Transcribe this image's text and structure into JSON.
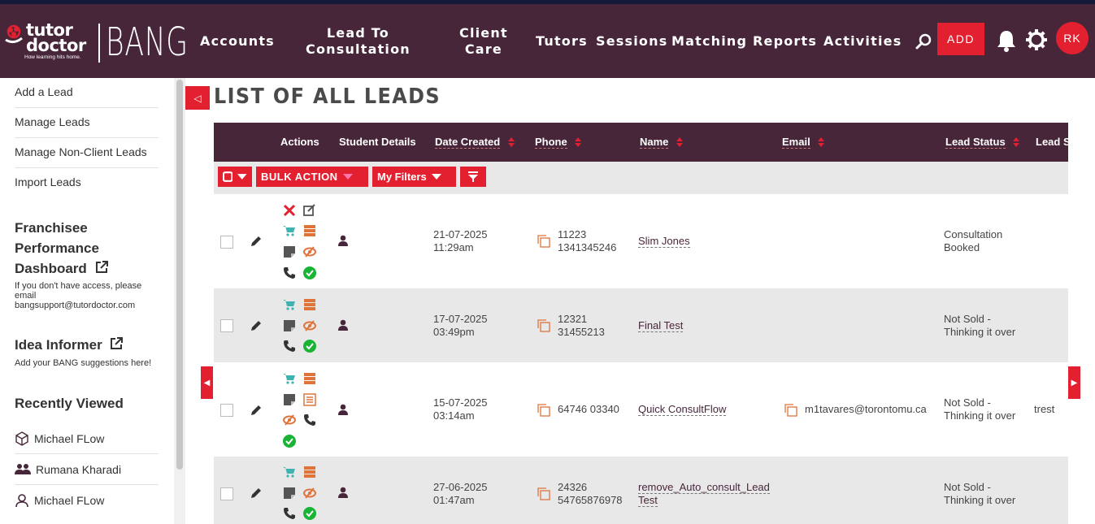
{
  "brand": {
    "logo_line1": "tutor",
    "logo_line2": "doctor",
    "logo_tagline": "How learning hits home.",
    "app_name": "BANG"
  },
  "nav": {
    "items": [
      {
        "label": "Accounts"
      },
      {
        "label": "Lead To\nConsultation"
      },
      {
        "label": "Client\nCare"
      },
      {
        "label": "Tutors"
      },
      {
        "label": "Sessions"
      },
      {
        "label": "Matching"
      },
      {
        "label": "Reports"
      },
      {
        "label": "Activities"
      }
    ],
    "add_label": "ADD",
    "avatar_initials": "RK",
    "icons": [
      "search-icon",
      "bell-icon",
      "gear-icon"
    ]
  },
  "sidebar": {
    "links": [
      "Add a Lead",
      "Manage Leads",
      "Manage Non-Client Leads",
      "Import Leads"
    ],
    "dashboard": {
      "line1": "Franchisee",
      "line2": "Performance",
      "line3": "Dashboard",
      "note": "If you don't have access, please email bangsupport@tutordoctor.com"
    },
    "idea": {
      "title": "Idea Informer",
      "note": "Add your BANG suggestions here!"
    },
    "recently_viewed": {
      "title": "Recently Viewed",
      "items": [
        {
          "label": "Michael FLow",
          "icon": "cube-icon"
        },
        {
          "label": "Rumana Kharadi",
          "icon": "users-icon"
        },
        {
          "label": "Michael FLow",
          "icon": "user-outline-icon"
        }
      ]
    }
  },
  "page": {
    "title": "LIST OF ALL LEADS"
  },
  "table": {
    "headers": [
      "Actions",
      "Student Details",
      "Date Created",
      "Phone",
      "Name",
      "Email",
      "Lead Status",
      "Lead St"
    ],
    "filters": {
      "bulk_action": "BULK ACTION",
      "my_filters": "My Filters"
    },
    "rows": [
      {
        "date": "21-07-2025",
        "time": "11:29am",
        "phone1": "11223",
        "phone2": "1341345246",
        "name1": "Slim Jones",
        "name2": "",
        "email": "",
        "status1": "Consultation",
        "status2": "Booked",
        "extra": ""
      },
      {
        "date": "17-07-2025",
        "time": "03:49pm",
        "phone1": "12321",
        "phone2": "31455213",
        "name1": "Final Test",
        "name2": "",
        "email": "",
        "status1": "Not Sold -",
        "status2": "Thinking it over",
        "extra": ""
      },
      {
        "date": "15-07-2025",
        "time": "03:14am",
        "phone1": "64746 03340",
        "phone2": "",
        "name1": "Quick ConsultFlow",
        "name2": "",
        "email": "m1tavares@torontomu.ca",
        "status1": "Not Sold -",
        "status2": "Thinking it over",
        "extra": "trest"
      },
      {
        "date": "27-06-2025",
        "time": "01:47am",
        "phone1": "24326",
        "phone2": "54765876978",
        "name1": "remove_Auto_consult_Lead",
        "name2": "Test",
        "email": "",
        "status1": "Not Sold -",
        "status2": "Thinking it over",
        "extra": ""
      }
    ]
  },
  "colors": {
    "brand_dark": "#48263a",
    "accent_red": "#e3202f",
    "icon_teal": "#3fb3b0",
    "icon_orange": "#e0733a",
    "icon_green": "#19b335"
  }
}
